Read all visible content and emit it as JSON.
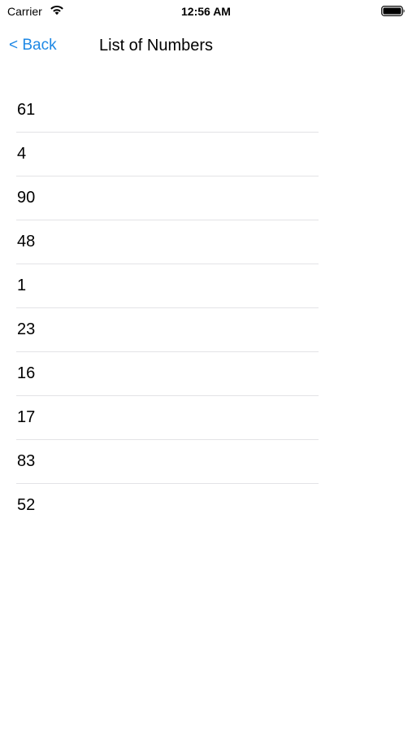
{
  "status_bar": {
    "carrier": "Carrier",
    "time": "12:56 AM"
  },
  "nav": {
    "back_label": "< Back",
    "title": "List of Numbers"
  },
  "list": {
    "items": [
      "61",
      "4",
      "90",
      "48",
      "1",
      "23",
      "16",
      "17",
      "83",
      "52"
    ]
  },
  "colors": {
    "accent": "#1e88e5",
    "separator": "#e3e3e6"
  },
  "icons": {
    "wifi": "wifi-icon",
    "battery": "battery-icon"
  }
}
